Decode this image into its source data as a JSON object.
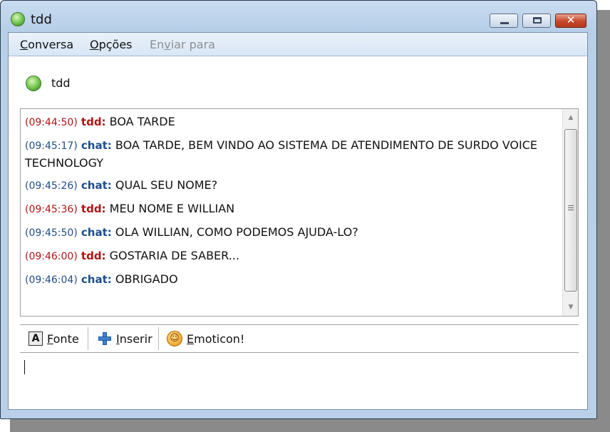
{
  "window": {
    "title": "tdd"
  },
  "menu": {
    "items": [
      {
        "before": "",
        "mnemonic": "C",
        "after": "onversa",
        "disabled": false
      },
      {
        "before": "",
        "mnemonic": "O",
        "after": "pções",
        "disabled": false
      },
      {
        "before": "En",
        "mnemonic": "v",
        "after": "iar para",
        "disabled": true
      }
    ]
  },
  "contact": {
    "name": "tdd"
  },
  "messages": [
    {
      "time": "(09:44:50)",
      "sender": "tdd:",
      "text": "BOA TARDE",
      "color": "red"
    },
    {
      "time": "(09:45:17)",
      "sender": "chat:",
      "text": "BOA TARDE, BEM VINDO AO SISTEMA DE ATENDIMENTO DE SURDO VOICE TECHNOLOGY",
      "color": "blue"
    },
    {
      "time": "(09:45:26)",
      "sender": "chat:",
      "text": "QUAL SEU NOME?",
      "color": "blue"
    },
    {
      "time": "(09:45:36)",
      "sender": "tdd:",
      "text": "MEU NOME E WILLIAN",
      "color": "red"
    },
    {
      "time": "(09:45:50)",
      "sender": "chat:",
      "text": "OLA WILLIAN, COMO PODEMOS AJUDA-LO?",
      "color": "blue"
    },
    {
      "time": "(09:46:00)",
      "sender": "tdd:",
      "text": "GOSTARIA DE SABER...",
      "color": "red"
    },
    {
      "time": "(09:46:04)",
      "sender": "chat:",
      "text": "OBRIGADO",
      "color": "blue"
    }
  ],
  "toolbar": {
    "font": {
      "mnemonic": "F",
      "after": "onte",
      "icon": "font-icon",
      "icon_glyph": "A"
    },
    "insert": {
      "mnemonic": "I",
      "after": "nserir",
      "icon": "plus-icon"
    },
    "emoticon": {
      "mnemonic": "E",
      "after": "moticon!",
      "icon": "smiley-icon",
      "icon_glyph": "☺"
    }
  },
  "colors": {
    "tdd": "#b01515",
    "chat": "#1f4e8c",
    "close_button": "#c5482a"
  }
}
